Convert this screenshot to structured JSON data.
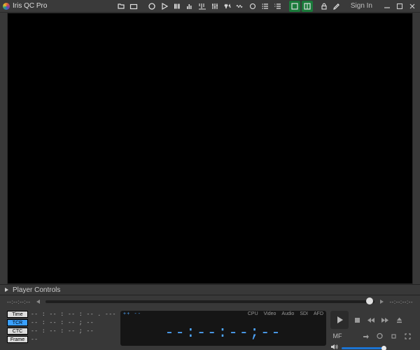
{
  "app": {
    "title": "Iris QC Pro",
    "signin": "Sign In"
  },
  "pcHeader": {
    "label": "Player Controls"
  },
  "timeline": {
    "left_tc": "--:--:--:--",
    "right_tc": "--:--:--:--"
  },
  "timecodes": {
    "labels": {
      "time": "Time",
      "tcr": "TCR",
      "ctc": "CTC",
      "frame": "Frame"
    },
    "active": "tcr",
    "values": {
      "time": "-- : -- : -- : -- . ---",
      "tcr": "-- : -- : -- ; --",
      "ctc": "-- : -- : -- ; --",
      "frame": "--"
    }
  },
  "status": {
    "lead": "++ --",
    "chips": {
      "cpu": "CPU",
      "video": "Video",
      "audio": "Audio",
      "sdi": "SDI",
      "afd": "AFD"
    },
    "big_tc": "--:--:--;--"
  },
  "transport": {
    "mf": "MF",
    "volume_pct": 100
  }
}
